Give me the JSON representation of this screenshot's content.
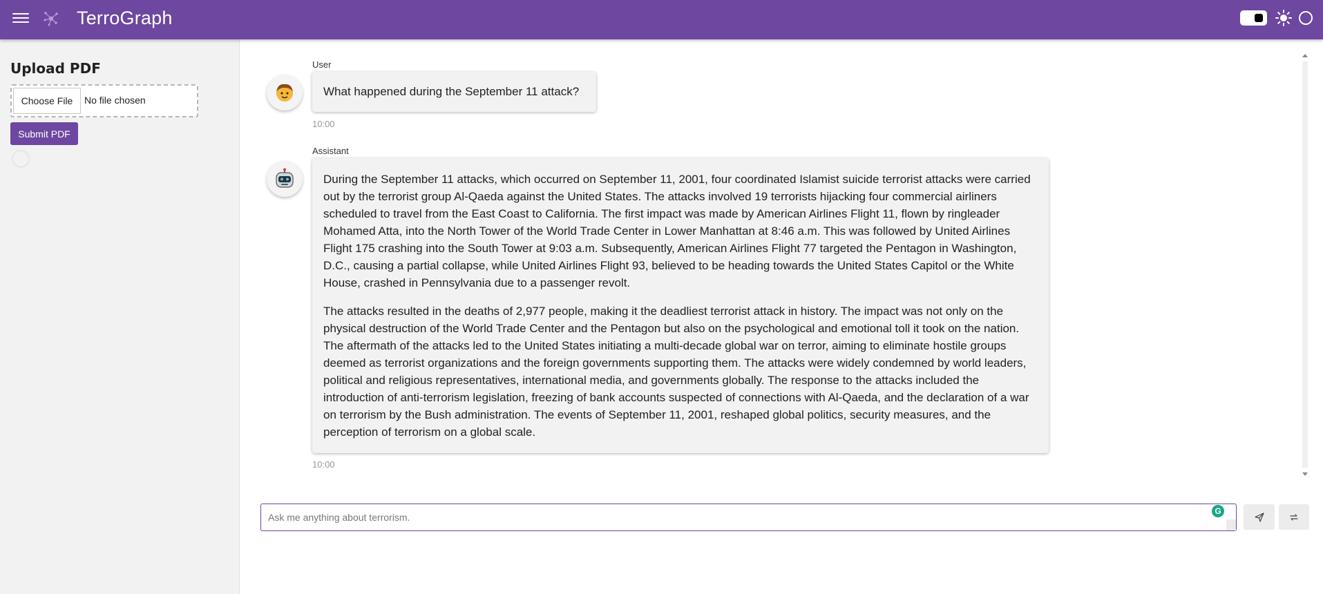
{
  "header": {
    "title": "TerroGraph",
    "menu_icon": "hamburger-menu-icon",
    "logo_icon": "network-graph-icon",
    "theme_icon": "sun-icon",
    "brand_color": "#6e47a0"
  },
  "sidebar": {
    "heading": "Upload PDF",
    "choose_file_label": "Choose File",
    "no_file_text": "No file chosen",
    "submit_label": "Submit PDF"
  },
  "messages": [
    {
      "sender": "User",
      "avatar_icon": "person-emoji-icon",
      "paragraphs": [
        "What happened during the September 11 attack?"
      ],
      "time": "10:00"
    },
    {
      "sender": "Assistant",
      "avatar_icon": "robot-emoji-icon",
      "paragraphs": [
        "During the September 11 attacks, which occurred on September 11, 2001, four coordinated Islamist suicide terrorist attacks were carried out by the terrorist group Al-Qaeda against the United States. The attacks involved 19 terrorists hijacking four commercial airliners scheduled to travel from the East Coast to California. The first impact was made by American Airlines Flight 11, flown by ringleader Mohamed Atta, into the North Tower of the World Trade Center in Lower Manhattan at 8:46 a.m. This was followed by United Airlines Flight 175 crashing into the South Tower at 9:03 a.m. Subsequently, American Airlines Flight 77 targeted the Pentagon in Washington, D.C., causing a partial collapse, while United Airlines Flight 93, believed to be heading towards the United States Capitol or the White House, crashed in Pennsylvania due to a passenger revolt.",
        "The attacks resulted in the deaths of 2,977 people, making it the deadliest terrorist attack in history. The impact was not only on the physical destruction of the World Trade Center and the Pentagon but also on the psychological and emotional toll it took on the nation. The aftermath of the attacks led to the United States initiating a multi-decade global war on terror, aiming to eliminate hostile groups deemed as terrorist organizations and the foreign governments supporting them. The attacks were widely condemned by world leaders, political and religious representatives, international media, and governments globally. The response to the attacks included the introduction of anti-terrorism legislation, freezing of bank accounts suspected of connections with Al-Qaeda, and the declaration of a war on terrorism by the Bush administration. The events of September 11, 2001, reshaped global politics, security measures, and the perception of terrorism on a global scale."
      ],
      "time": "10:00"
    }
  ],
  "input": {
    "placeholder": "Ask me anything about terrorism.",
    "value": ""
  },
  "icons": {
    "send": "send-icon",
    "refresh": "refresh-icon",
    "grammar": "grammarly-icon"
  }
}
